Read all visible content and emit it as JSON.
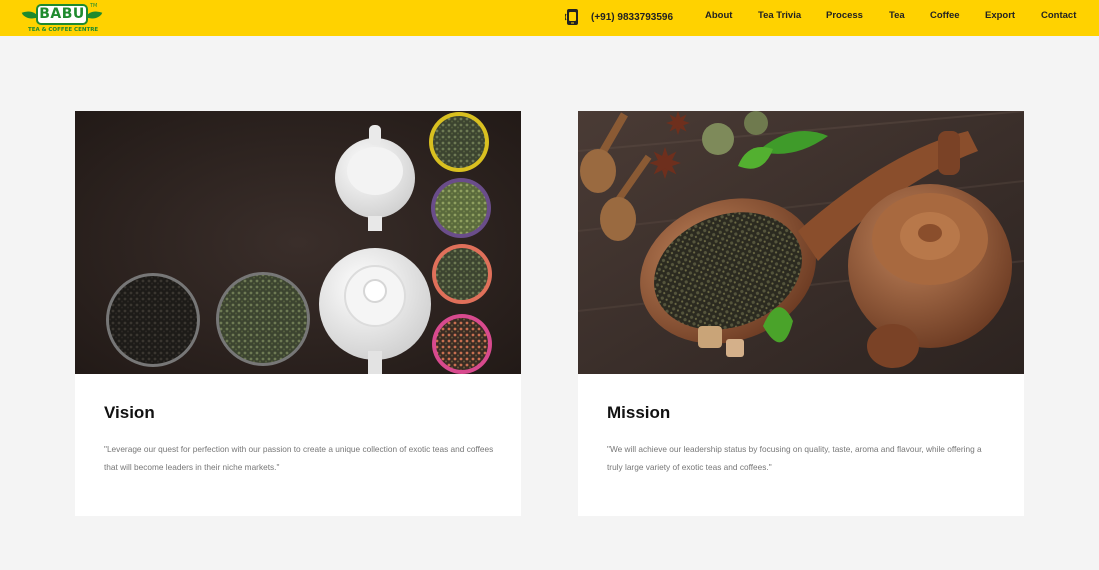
{
  "header": {
    "logo": {
      "name": "BABU",
      "tm": "TM",
      "subtitle": "TEA & COFFEE CENTRE"
    },
    "phone": "(+91) 9833793596",
    "nav": [
      "About",
      "Tea Trivia",
      "Process",
      "Tea",
      "Coffee",
      "Export",
      "Contact"
    ]
  },
  "colors": {
    "header_bg": "#ffd200",
    "brand_green": "#1f8a2e"
  },
  "cards": [
    {
      "title": "Vision",
      "text": "\"Leverage our quest for perfection with our passion to create a unique collection of exotic teas and coffees that will become leaders in their niche markets.\""
    },
    {
      "title": "Mission",
      "text": "\"We will achieve our leadership status by focusing on quality, taste, aroma and flavour, while offering a truly large variety of exotic teas and coffees.\""
    }
  ]
}
